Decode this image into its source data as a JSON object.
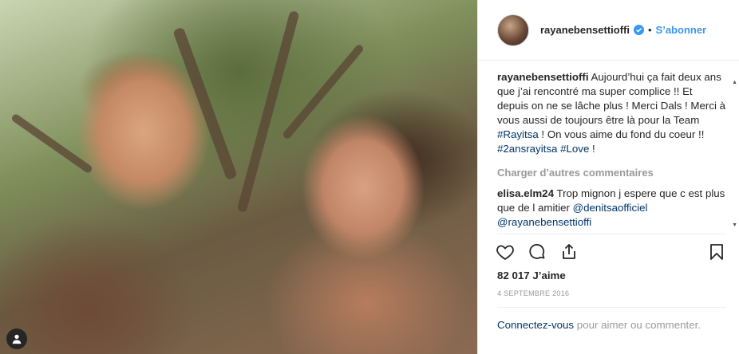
{
  "post": {
    "username": "rayanebensettioffi",
    "dot": "•",
    "follow_label": "S’abonner",
    "caption": {
      "username": "rayanebensettioffi",
      "text_1": " Aujourd’hui ça fait deux ans que j’ai rencontré ma super complice !! Et depuis on ne se lâche plus ! Merci Dals ! Merci à vous aussi de toujours être là pour la Team ",
      "tag_1": "#Rayitsa",
      "text_2": " ! On vous aime du fond du coeur !! ",
      "tag_2": "#2ansrayitsa",
      "text_3": " ",
      "tag_3": "#Love",
      "text_4": " !"
    },
    "load_more_label": "Charger d’autres commentaires",
    "comment": {
      "username": "elisa.elm24",
      "text_1": " Trop mignon j espere que c est plus que de l amitier ",
      "mention_1": "@denitsaofficiel",
      "text_2": " ",
      "mention_2": "@rayanebensettioffi"
    },
    "likes": "82 017 J’aime",
    "date": "4 SEPTEMBRE 2016",
    "login_link": "Connectez-vous",
    "login_rest": " pour aimer ou commenter."
  },
  "icons": {
    "verified": "verified-badge-icon",
    "like": "heart-icon",
    "comment": "comment-icon",
    "share": "share-icon",
    "save": "bookmark-icon",
    "user_tag": "user-tag-icon"
  },
  "colors": {
    "link_blue": "#3897f0",
    "tag_blue": "#003569",
    "muted": "#999999",
    "text": "#262626"
  }
}
